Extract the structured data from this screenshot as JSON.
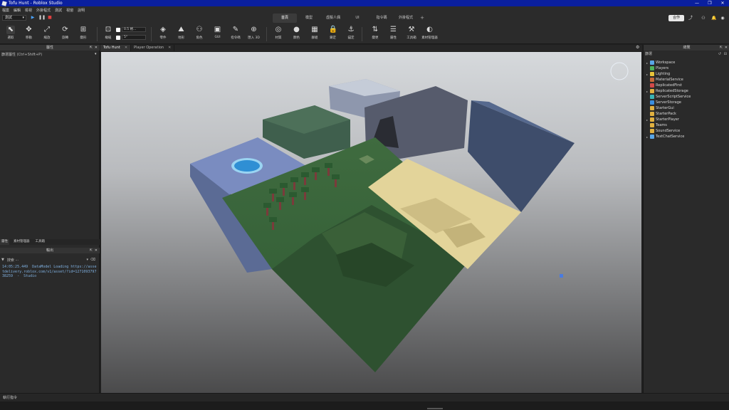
{
  "window": {
    "title": "Tofu Hunt - Roblox Studio",
    "minimize": "—",
    "maximize": "❐",
    "close": "✕"
  },
  "menu": [
    "檔案",
    "編輯",
    "檢視",
    "外掛程式",
    "測試",
    "視窗",
    "說明"
  ],
  "toprow": {
    "test_mode": "測試",
    "tabs": [
      {
        "label": "首頁",
        "active": true
      },
      {
        "label": "模型",
        "active": false
      },
      {
        "label": "虛擬人偶",
        "active": false
      },
      {
        "label": "UI",
        "active": false
      },
      {
        "label": "指令碼",
        "active": false
      },
      {
        "label": "外掛程式",
        "active": false
      }
    ],
    "add_tab": "+",
    "collab": "合作"
  },
  "ribbon": {
    "tools": [
      {
        "label": "選取",
        "icon": "select-icon",
        "glyph": "⬉"
      },
      {
        "label": "移動",
        "icon": "move-icon",
        "glyph": "✥"
      },
      {
        "label": "縮放",
        "icon": "scale-icon",
        "glyph": "⤢"
      },
      {
        "label": "旋轉",
        "icon": "rotate-icon",
        "glyph": "⟳"
      },
      {
        "label": "變形",
        "icon": "transform-icon",
        "glyph": "⊞"
      }
    ],
    "pivot": {
      "label": "樞紐",
      "glyph": "⊡"
    },
    "snap": {
      "move_value": "0.5 格...",
      "rotate_value": "5°"
    },
    "insert_tools": [
      {
        "label": "零件",
        "glyph": "◈"
      },
      {
        "label": "地形",
        "glyph": "⛰"
      },
      {
        "label": "角色",
        "glyph": "⚇"
      },
      {
        "label": "GUI",
        "glyph": "▣"
      },
      {
        "label": "指令碼",
        "glyph": "✎"
      },
      {
        "label": "匯入 3D",
        "glyph": "⊕"
      }
    ],
    "edit_tools": [
      {
        "label": "材質",
        "glyph": "◎"
      },
      {
        "label": "顏色",
        "glyph": "●"
      },
      {
        "label": "群組",
        "glyph": "▦"
      },
      {
        "label": "鎖定",
        "glyph": "🔒"
      },
      {
        "label": "錨定",
        "glyph": "⚓"
      }
    ],
    "panel_tools": [
      {
        "label": "變更",
        "glyph": "⇅"
      },
      {
        "label": "屬性",
        "glyph": "☰"
      },
      {
        "label": "工具箱",
        "glyph": "⚒"
      },
      {
        "label": "素材管理器",
        "glyph": "◐"
      }
    ]
  },
  "left": {
    "properties_title": "屬性",
    "filter_properties": "篩選屬性 (Ctrl+Shift+P)",
    "bottom_tabs": [
      "屬性",
      "素材管理器",
      "工具箱"
    ],
    "output_title": "輸出",
    "output_filter": "搜索 ···",
    "output_log": "14:05:25.449  DataModel Loading https://assetdelivery.roblox.com/v1/asset/?id=127109379738259  -  Studio"
  },
  "doctabs": [
    {
      "label": "Tofu Hunt",
      "active": true
    },
    {
      "label": "Player Operation",
      "active": false
    }
  ],
  "explorer": {
    "title": "總覽",
    "filter": "篩選",
    "items": [
      {
        "label": "Workspace",
        "expandable": true,
        "color": "#5aa6e6"
      },
      {
        "label": "Players",
        "expandable": false,
        "color": "#4fb35a"
      },
      {
        "label": "Lighting",
        "expandable": true,
        "color": "#e8c43a"
      },
      {
        "label": "MaterialService",
        "expandable": false,
        "color": "#c86b3a"
      },
      {
        "label": "ReplicatedFirst",
        "expandable": false,
        "color": "#d24a4a"
      },
      {
        "label": "ReplicatedStorage",
        "expandable": true,
        "color": "#e0b040"
      },
      {
        "label": "ServerScriptService",
        "expandable": false,
        "color": "#3ab4b4"
      },
      {
        "label": "ServerStorage",
        "expandable": false,
        "color": "#3a8ee0"
      },
      {
        "label": "StarterGui",
        "expandable": false,
        "color": "#e0b040"
      },
      {
        "label": "StarterPack",
        "expandable": false,
        "color": "#e0b040"
      },
      {
        "label": "StarterPlayer",
        "expandable": true,
        "color": "#e0b040"
      },
      {
        "label": "Teams",
        "expandable": false,
        "color": "#e0b040"
      },
      {
        "label": "SoundService",
        "expandable": false,
        "color": "#e0b040"
      },
      {
        "label": "TextChatService",
        "expandable": true,
        "color": "#5aa6e6"
      }
    ]
  },
  "cmdbar": {
    "label": "執行指令"
  }
}
